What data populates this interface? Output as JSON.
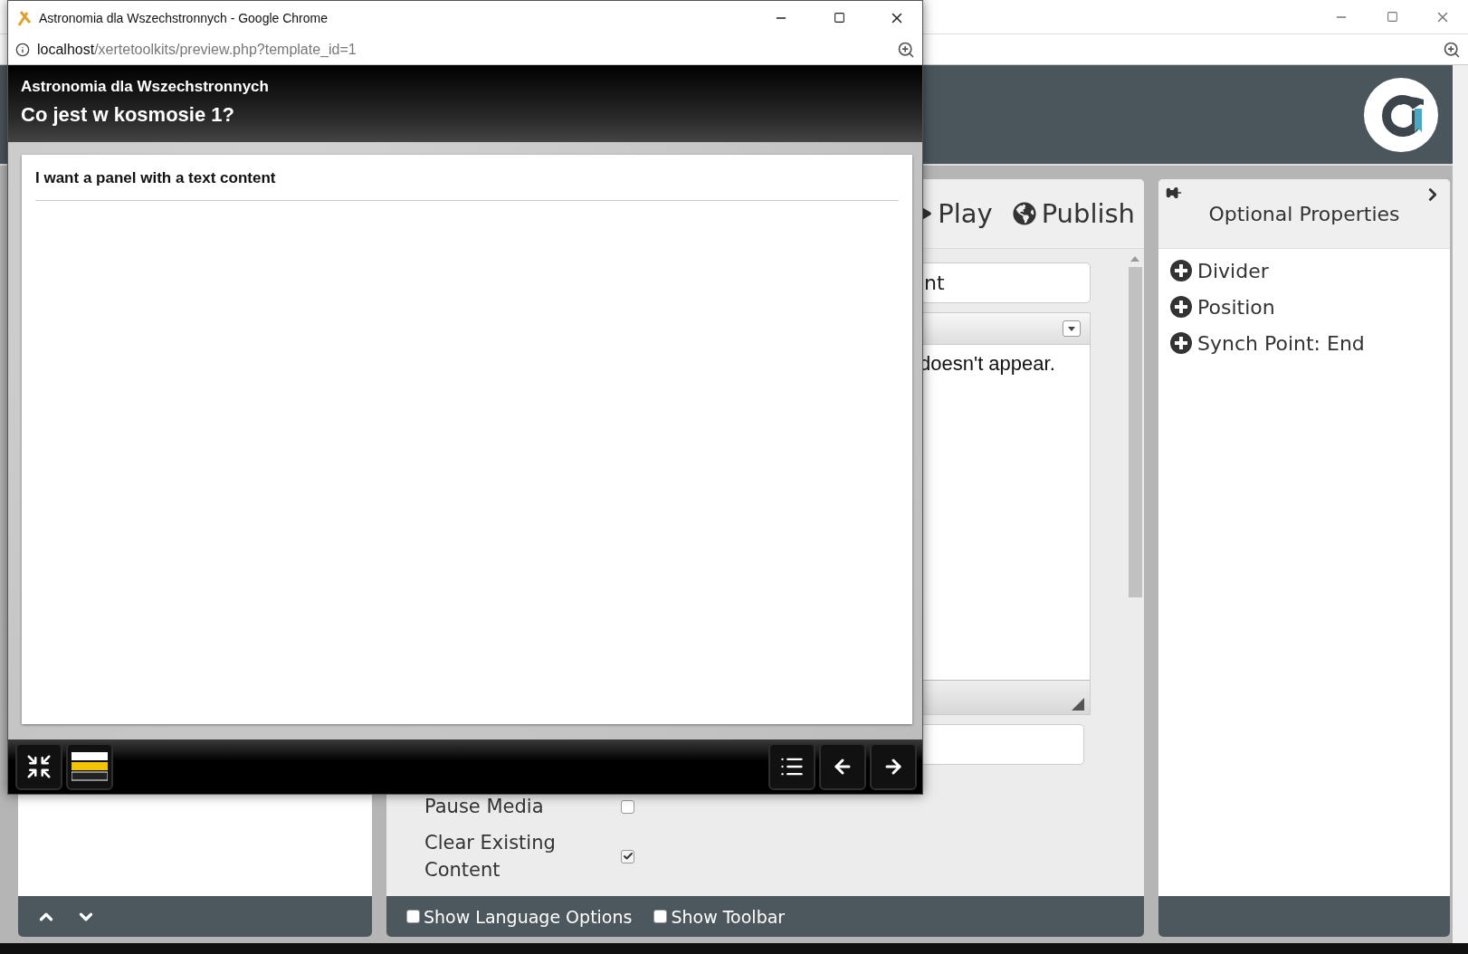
{
  "editor_toolbar": {
    "buttons": [
      {
        "label": "Play",
        "kind": "play"
      },
      {
        "label": "Publish",
        "kind": "publish"
      }
    ]
  },
  "form": {
    "text_field": {
      "value": "nt"
    },
    "editor": {
      "text": "doesn't appear."
    },
    "rows": [
      {
        "label": "Pause Media",
        "checked": false
      },
      {
        "label": "Clear Existing Content",
        "checked": true
      }
    ]
  },
  "footer_options": [
    {
      "label": "Show Language Options",
      "checked": false
    },
    {
      "label": "Show Toolbar",
      "checked": false
    }
  ],
  "optional_properties": {
    "title": "Optional Properties",
    "items": [
      "Divider",
      "Position",
      "Synch Point: End"
    ]
  },
  "preview_window": {
    "title": "Astronomia dla Wszechstronnych - Google Chrome",
    "url_host": "localhost",
    "url_path": "/xertetoolkits/preview.php?template_id=1",
    "course_title": "Astronomia dla Wszechstronnych",
    "page_title": "Co jest w kosmosie 1?",
    "panel_heading": "I want a panel with a text content"
  }
}
